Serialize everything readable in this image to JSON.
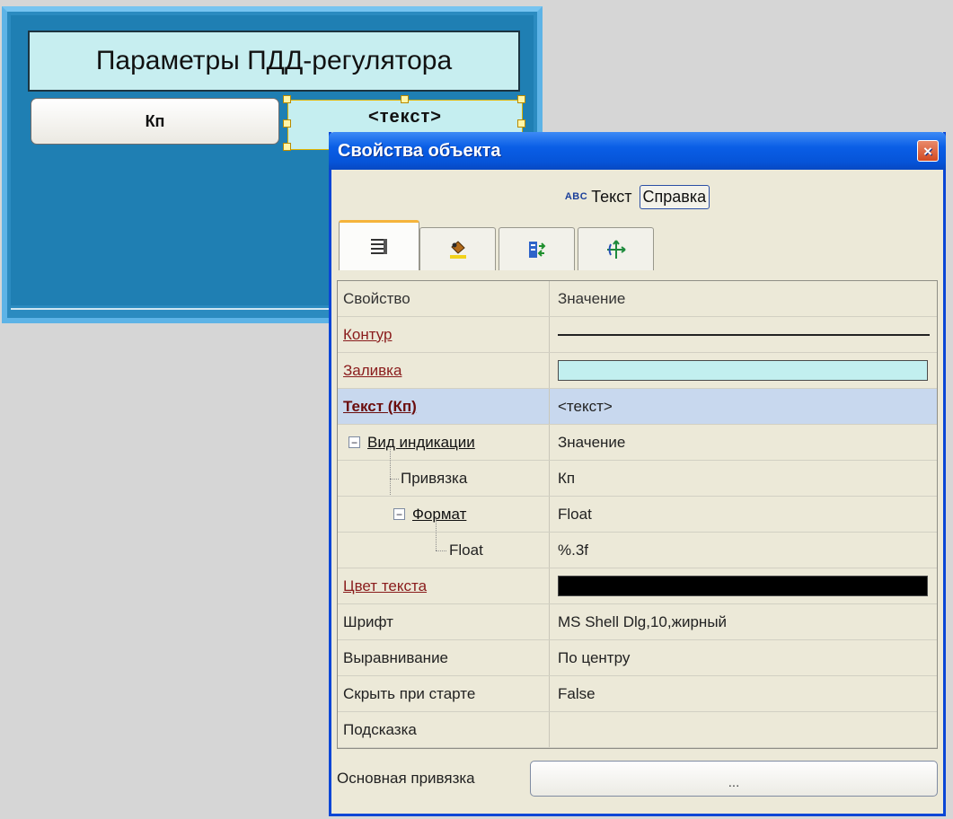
{
  "canvas": {
    "title": "Параметры ПДД-регулятора",
    "kp_button": "Кп",
    "text_field": "<текст>"
  },
  "window": {
    "title": "Свойства объекта",
    "close_glyph": "×",
    "object_type_icon": "ABC",
    "object_type": "Текст",
    "help_button": "Справка",
    "tabs": [
      {
        "icon": "list-properties-icon",
        "active": true
      },
      {
        "icon": "paint-bucket-icon",
        "active": false
      },
      {
        "icon": "actions-icon",
        "active": false
      },
      {
        "icon": "move-arrows-icon",
        "active": false
      }
    ]
  },
  "grid": {
    "header": {
      "name": "Свойство",
      "value": "Значение"
    },
    "rows": [
      {
        "name": "Контур",
        "value": ""
      },
      {
        "name": "Заливка",
        "value": ""
      },
      {
        "name": "Текст (Кп)",
        "value": "<текст>"
      },
      {
        "name": "Вид индикации",
        "value": "Значение"
      },
      {
        "name": "Привязка",
        "value": "Кп"
      },
      {
        "name": "Формат",
        "value": "Float"
      },
      {
        "name": "Float",
        "value": "%.3f"
      },
      {
        "name": "Цвет текста",
        "value": ""
      },
      {
        "name": "Шрифт",
        "value": "MS Shell Dlg,10,жирный"
      },
      {
        "name": "Выравнивание",
        "value": "По центру"
      },
      {
        "name": "Скрыть при старте",
        "value": "False"
      },
      {
        "name": "Подсказка",
        "value": ""
      }
    ],
    "fill_color": "#c2efef",
    "text_color": "#000000",
    "selected_row_color": "#c8d8ee"
  },
  "bottom": {
    "label": "Основная привязка",
    "button": "..."
  },
  "colors": {
    "canvas_blue": "#1f7fb3",
    "title_bar_blue": "#0a5ee6",
    "selection_handle": "#e0b300"
  }
}
